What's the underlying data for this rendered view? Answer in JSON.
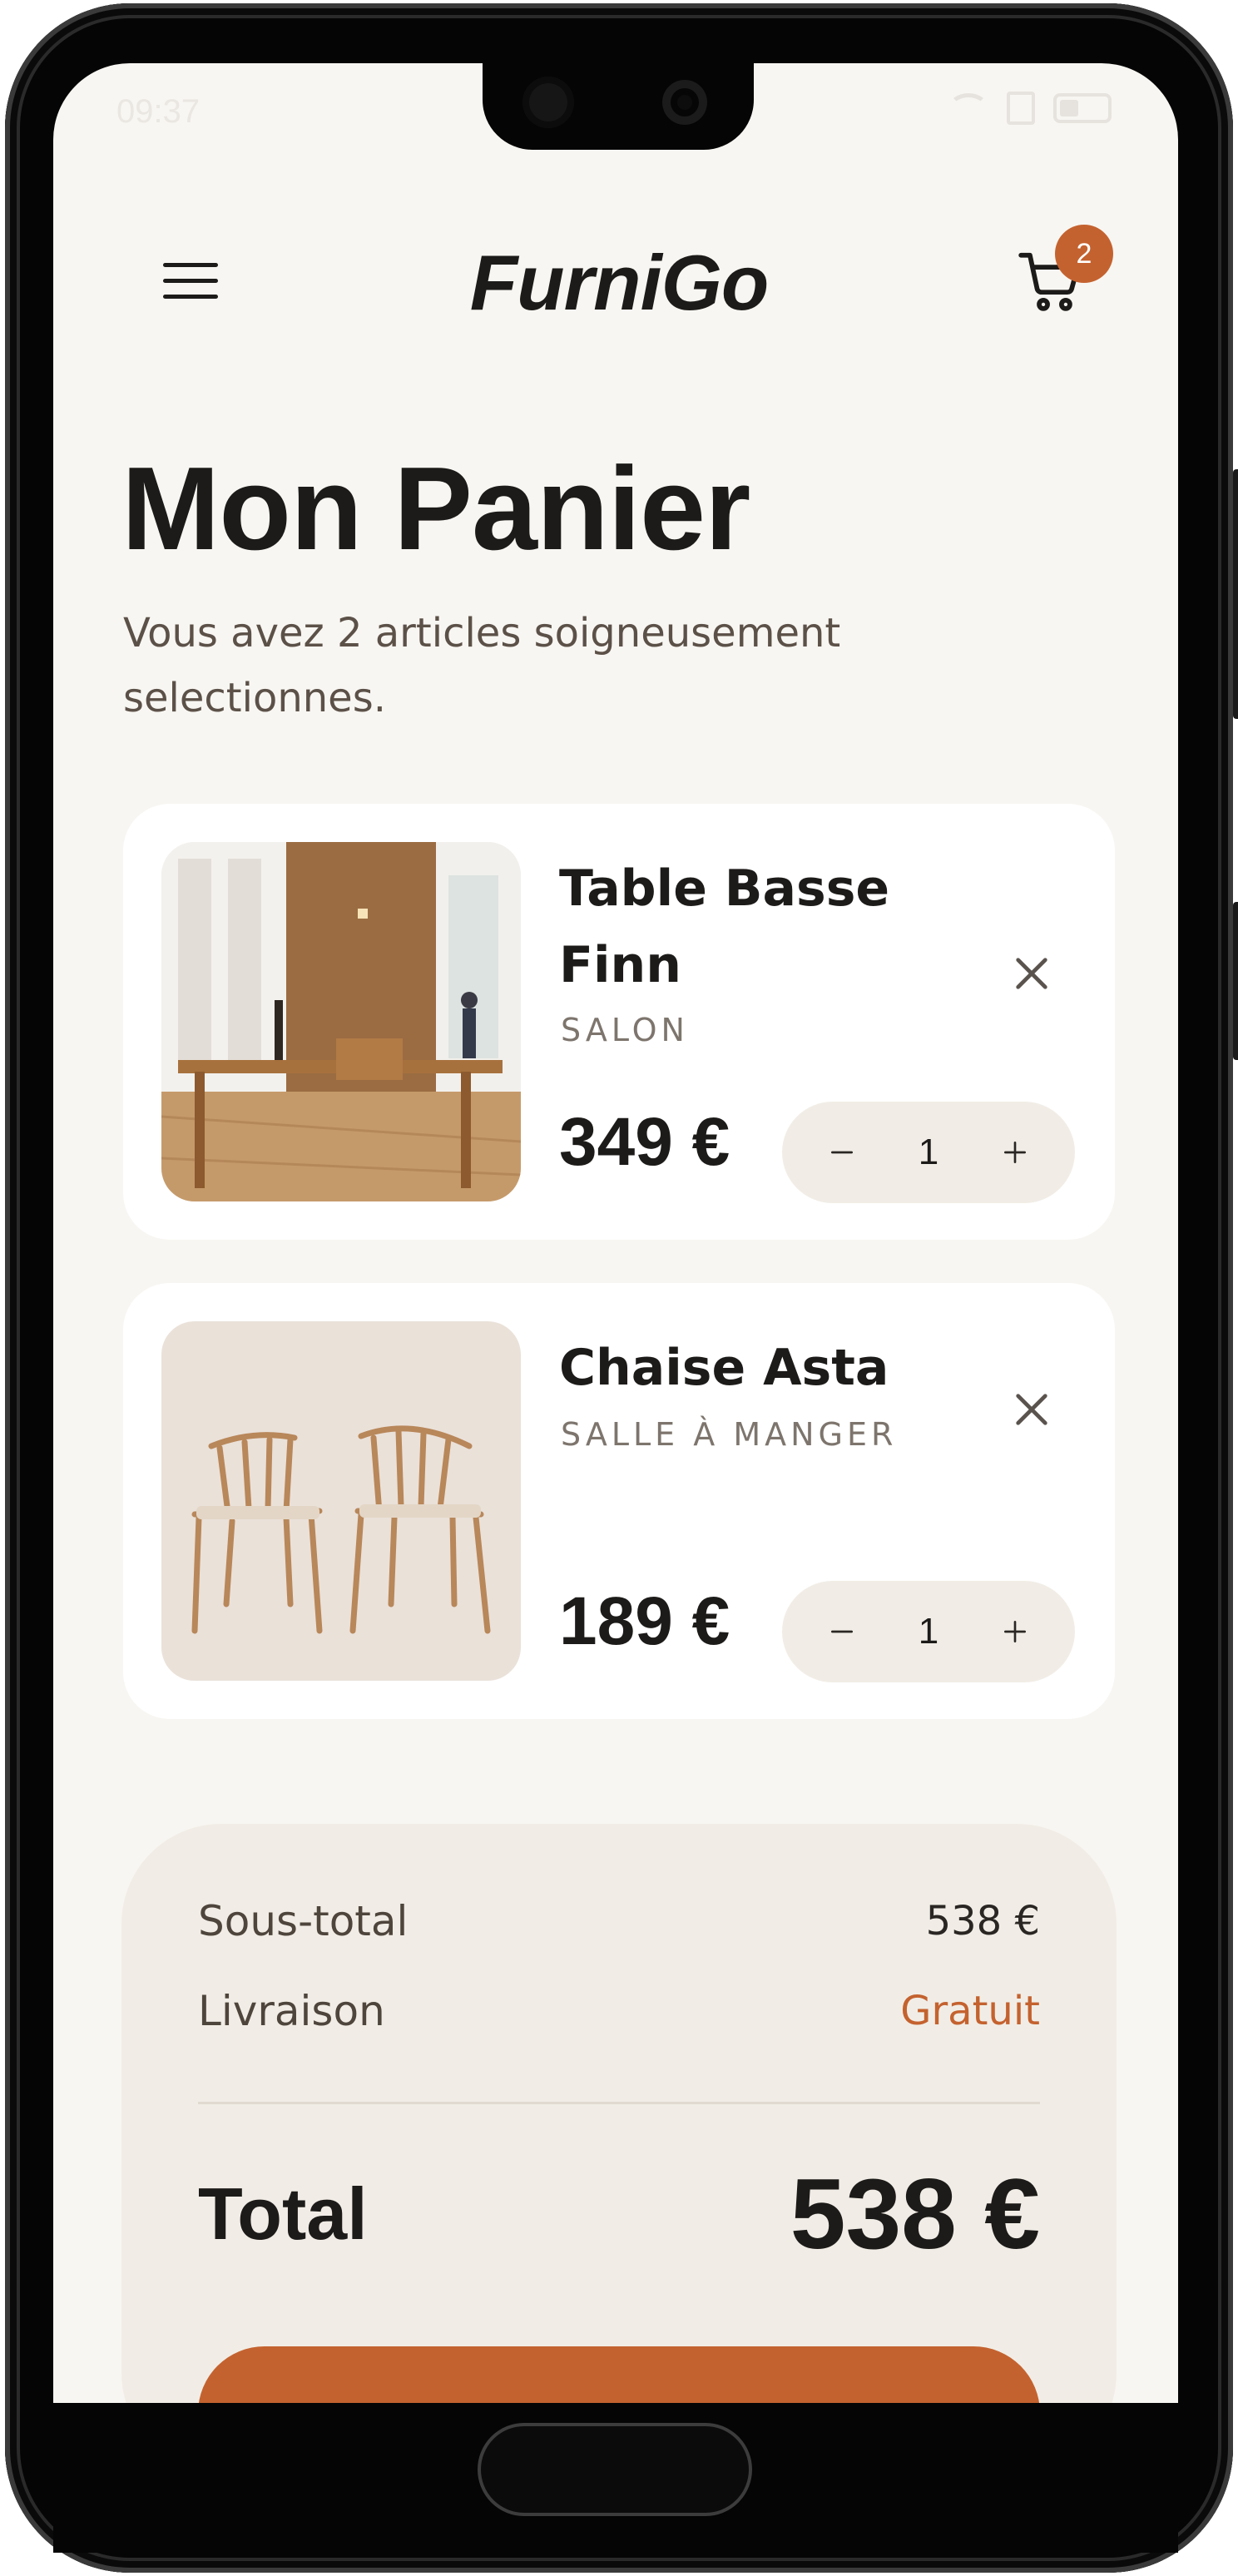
{
  "status_bar": {
    "time": "09:37"
  },
  "header": {
    "brand": "FurniGo",
    "cart_count": "2"
  },
  "page": {
    "title": "Mon Panier",
    "subtitle": "Vous avez 2 articles soigneusement selectionnes."
  },
  "cart_items": [
    {
      "name": "Table Basse Finn",
      "category": "SALON",
      "price": "349 €",
      "quantity": "1"
    },
    {
      "name": "Chaise Asta",
      "category": "SALLE À MANGER",
      "price": "189 €",
      "quantity": "1"
    }
  ],
  "summary": {
    "subtotal_label": "Sous-total",
    "subtotal_value": "538 €",
    "shipping_label": "Livraison",
    "shipping_value": "Gratuit",
    "total_label": "Total",
    "total_value": "538 €"
  },
  "colors": {
    "accent": "#c4622f",
    "background": "#f8f6f2",
    "card": "#ffffff",
    "summary_bg": "#f1ede6",
    "text": "#1d1b19"
  },
  "icons": [
    "menu-icon",
    "cart-icon",
    "close-icon",
    "minus-icon",
    "plus-icon"
  ]
}
